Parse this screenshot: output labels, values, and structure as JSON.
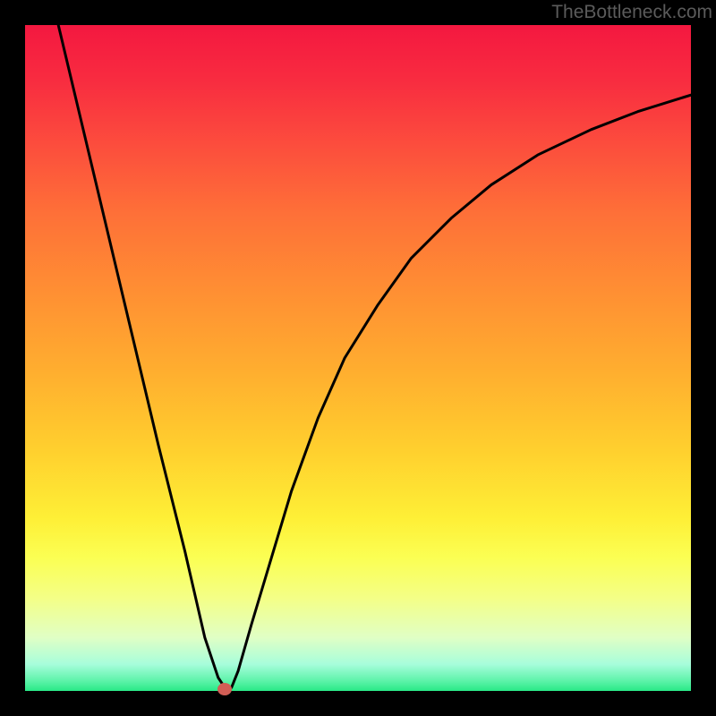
{
  "watermark": "TheBottleneck.com",
  "chart_data": {
    "type": "line",
    "title": "",
    "xlabel": "",
    "ylabel": "",
    "xlim": [
      0,
      100
    ],
    "ylim": [
      0,
      100
    ],
    "grid": false,
    "series": [
      {
        "name": "curve",
        "x": [
          5,
          10,
          15,
          20,
          24,
          27,
          29,
          30,
          30.5,
          31,
          32,
          34,
          37,
          40,
          44,
          48,
          53,
          58,
          64,
          70,
          77,
          85,
          92,
          100
        ],
        "values": [
          100,
          79,
          58,
          37,
          21,
          8,
          2,
          0.5,
          0.3,
          0.5,
          3,
          10,
          20,
          30,
          41,
          50,
          58,
          65,
          71,
          76,
          80.5,
          84.3,
          87,
          89.5
        ]
      }
    ],
    "marker": {
      "x": 30,
      "y": 0.3
    },
    "background_gradient": {
      "top": "#f41840",
      "mid": "#ffd02e",
      "bottom": "#29e986"
    }
  }
}
